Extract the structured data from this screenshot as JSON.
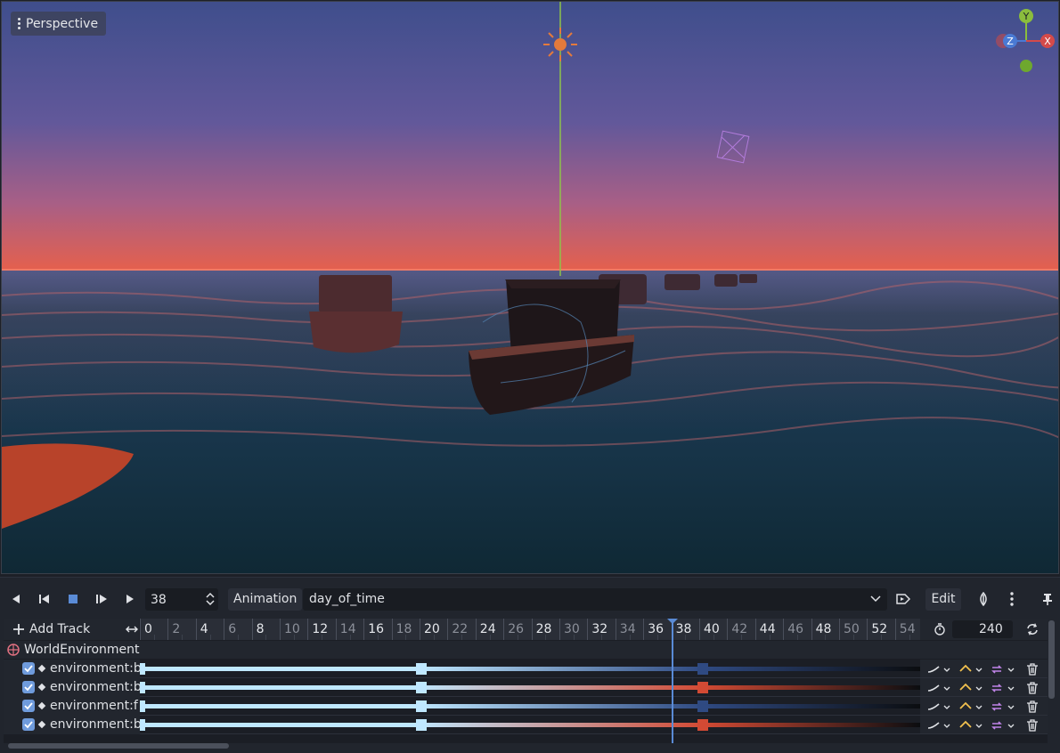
{
  "viewport": {
    "mode_label": "Perspective",
    "gizmo_axes": [
      "Y",
      "Z",
      "X"
    ]
  },
  "toolbar": {
    "frame_value": "38",
    "animation_label": "Animation",
    "animation_name": "day_of_time",
    "edit_label": "Edit"
  },
  "timeline": {
    "add_track_label": "Add Track",
    "ruler_ticks": [
      "0",
      "2",
      "4",
      "6",
      "8",
      "10",
      "12",
      "14",
      "16",
      "18",
      "20",
      "22",
      "24",
      "26",
      "28",
      "30",
      "32",
      "34",
      "36",
      "38",
      "40",
      "42",
      "44",
      "46",
      "48",
      "50",
      "52",
      "54"
    ],
    "major_ticks": [
      "0",
      "4",
      "8",
      "12",
      "16",
      "20",
      "24",
      "28",
      "32",
      "36",
      "38",
      "40",
      "44",
      "48",
      "52"
    ],
    "length_value": "240",
    "current_frame": 38,
    "group_name": "WorldEnvironment",
    "tracks": [
      {
        "label": "environment:b",
        "key_color": "#2f4a82"
      },
      {
        "label": "environment:b",
        "key_color": "#d24a34"
      },
      {
        "label": "environment:f",
        "key_color": "#2f4a82"
      },
      {
        "label": "environment:b",
        "key_color": "#d24a34"
      }
    ]
  },
  "colors": {
    "accent": "#5a8bd6",
    "key_light": "#bfe8ff",
    "panel": "#21252d"
  }
}
